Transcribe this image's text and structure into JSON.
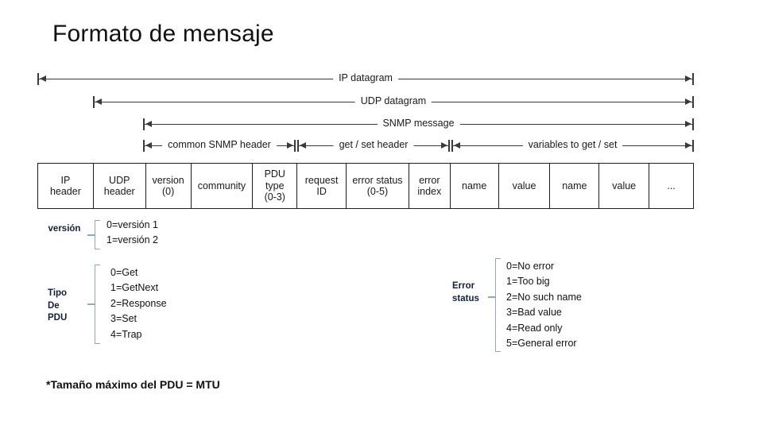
{
  "slide": {
    "title": "Formato de mensaje",
    "footnote": "*Tamaño máximo del PDU = MTU"
  },
  "scope_rows": [
    {
      "label": "IP datagram"
    },
    {
      "label": "UDP datagram"
    },
    {
      "label": "SNMP message"
    }
  ],
  "segment_row": [
    {
      "label": "common SNMP header"
    },
    {
      "label": "get / set header"
    },
    {
      "label": "variables to get / set"
    }
  ],
  "field_boxes": [
    {
      "l1": "IP",
      "l2": "header",
      "l3": ""
    },
    {
      "l1": "UDP",
      "l2": "header",
      "l3": ""
    },
    {
      "l1": "version",
      "l2": "(0)",
      "l3": ""
    },
    {
      "l1": "community",
      "l2": "",
      "l3": ""
    },
    {
      "l1": "PDU",
      "l2": "type",
      "l3": "(0-3)"
    },
    {
      "l1": "request",
      "l2": "ID",
      "l3": ""
    },
    {
      "l1": "error status",
      "l2": "(0-5)",
      "l3": ""
    },
    {
      "l1": "error",
      "l2": "index",
      "l3": ""
    },
    {
      "l1": "name",
      "l2": "",
      "l3": ""
    },
    {
      "l1": "value",
      "l2": "",
      "l3": ""
    },
    {
      "l1": "name",
      "l2": "",
      "l3": ""
    },
    {
      "l1": "value",
      "l2": "",
      "l3": ""
    },
    {
      "l1": "...",
      "l2": "",
      "l3": ""
    }
  ],
  "annotations": {
    "version": {
      "title": "versión",
      "items": [
        "0=versión 1",
        "1=versión 2"
      ]
    },
    "pdu_type": {
      "title_line1": "Tipo",
      "title_line2": "De",
      "title_line3": "PDU",
      "items": [
        "0=Get",
        "1=GetNext",
        "2=Response",
        "3=Set",
        "4=Trap"
      ]
    },
    "error_status": {
      "title_line1": "Error",
      "title_line2": "status",
      "items": [
        "0=No error",
        "1=Too big",
        "2=No such name",
        "3=Bad value",
        "4=Read only",
        "5=General error"
      ]
    }
  },
  "colors": {
    "bracket": "#8fa8bd",
    "box_border": "#1d1d1d",
    "arrow": "#3a3a3a",
    "annot_title": "#11203a"
  }
}
